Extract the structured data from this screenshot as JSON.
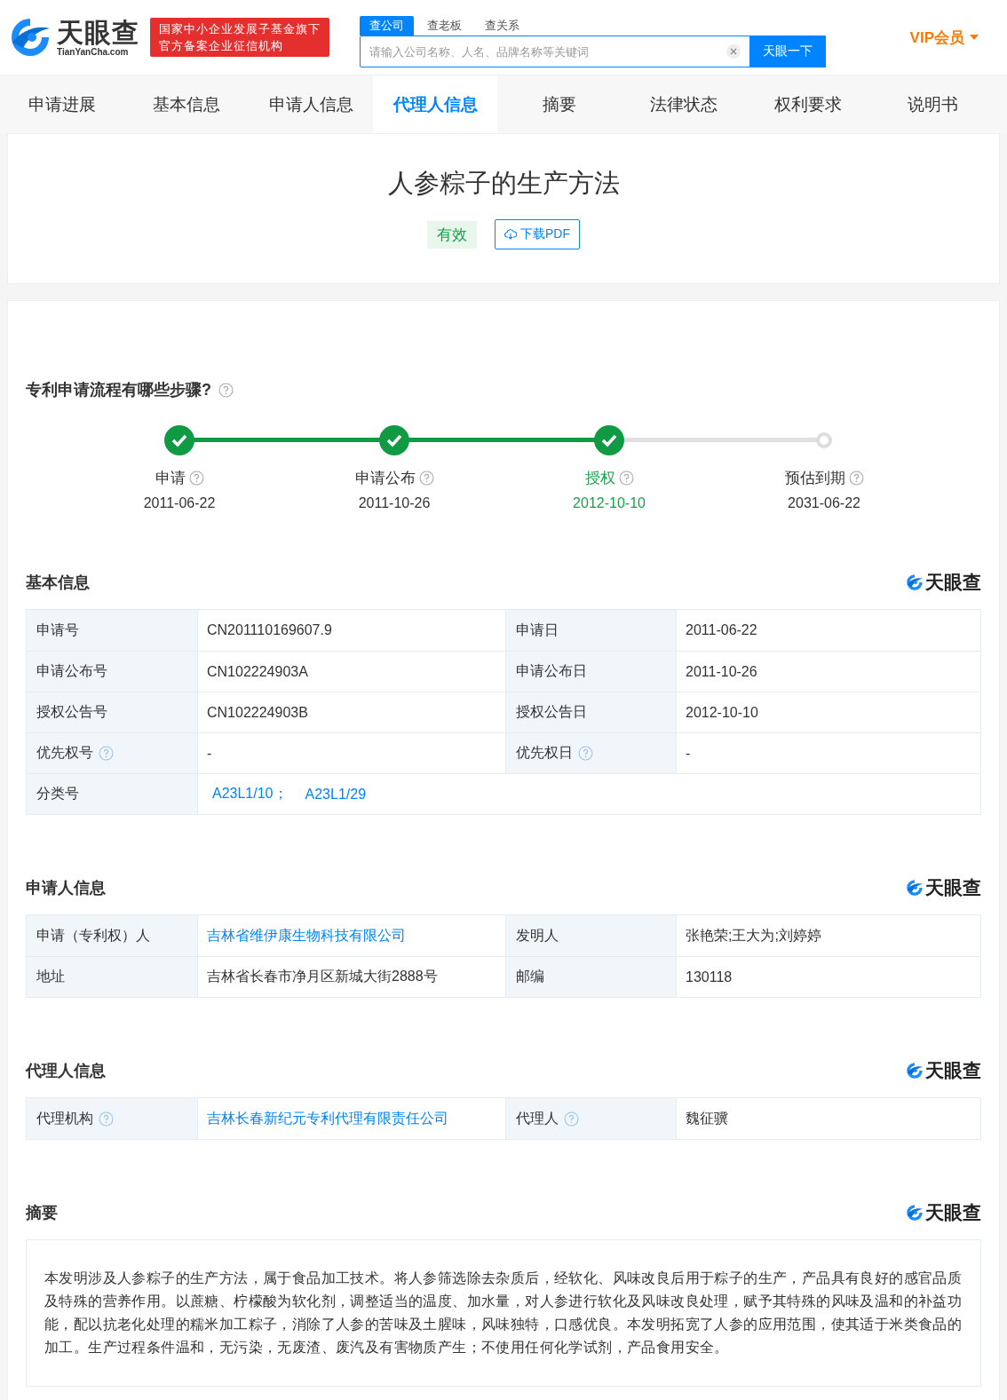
{
  "header": {
    "logo_name": "天眼查",
    "logo_domain": "TianYanCha.com",
    "badge_lines": [
      "国家中小企业发展子基金旗下",
      "官方备案企业征信机构"
    ],
    "search_tabs": [
      {
        "label": "查公司",
        "selected": true
      },
      {
        "label": "查老板",
        "selected": false
      },
      {
        "label": "查关系",
        "selected": false
      }
    ],
    "search_placeholder": "请输入公司名称、人名、品牌名称等关键词",
    "search_button": "天眼一下",
    "vip": "VIP会员"
  },
  "nav_tabs": [
    {
      "label": "申请进展",
      "selected": false
    },
    {
      "label": "基本信息",
      "selected": false
    },
    {
      "label": "申请人信息",
      "selected": false
    },
    {
      "label": "代理人信息",
      "selected": true
    },
    {
      "label": "摘要",
      "selected": false
    },
    {
      "label": "法律状态",
      "selected": false
    },
    {
      "label": "权利要求",
      "selected": false
    },
    {
      "label": "说明书",
      "selected": false
    }
  ],
  "title": "人参粽子的生产方法",
  "status": "有效",
  "download": "下载PDF",
  "process": {
    "title": "专利申请流程有哪些步骤?",
    "steps": [
      {
        "label": "申请",
        "date": "2011-06-22",
        "done": true,
        "current": false
      },
      {
        "label": "申请公布",
        "date": "2011-10-26",
        "done": true,
        "current": false
      },
      {
        "label": "授权",
        "date": "2012-10-10",
        "done": true,
        "current": true
      },
      {
        "label": "预估到期",
        "date": "2031-06-22",
        "done": false,
        "current": false
      }
    ]
  },
  "sections": [
    {
      "title": "基本信息",
      "brand": "天眼查",
      "rows": [
        [
          {
            "label": "申请号",
            "help": false,
            "value": "CN201110169607.9"
          },
          {
            "label": "申请日",
            "help": false,
            "value": "2011-06-22"
          }
        ],
        [
          {
            "label": "申请公布号",
            "help": false,
            "value": "CN102224903A"
          },
          {
            "label": "申请公布日",
            "help": false,
            "value": "2011-10-26"
          }
        ],
        [
          {
            "label": "授权公告号",
            "help": false,
            "value": "CN102224903B"
          },
          {
            "label": "授权公告日",
            "help": false,
            "value": "2012-10-10"
          }
        ],
        [
          {
            "label": "优先权号",
            "help": true,
            "value": "-"
          },
          {
            "label": "优先权日",
            "help": true,
            "value": "-"
          }
        ],
        [
          {
            "label": "分类号",
            "help": false,
            "links": [
              "A23L1/10；",
              "A23L1/29"
            ]
          }
        ]
      ]
    },
    {
      "title": "申请人信息",
      "brand": "天眼查",
      "rows": [
        [
          {
            "label": "申请（专利权）人",
            "help": false,
            "links": [
              "吉林省维伊康生物科技有限公司"
            ]
          },
          {
            "label": "发明人",
            "help": false,
            "value": "张艳荣;王大为;刘婷婷"
          }
        ],
        [
          {
            "label": "地址",
            "help": false,
            "value": "吉林省长春市净月区新城大街2888号"
          },
          {
            "label": "邮编",
            "help": false,
            "value": "130118"
          }
        ]
      ]
    },
    {
      "title": "代理人信息",
      "brand": "天眼查",
      "rows": [
        [
          {
            "label": "代理机构",
            "help": true,
            "links": [
              "吉林长春新纪元专利代理有限责任公司"
            ]
          },
          {
            "label": "代理人",
            "help": true,
            "value": "魏征骥"
          }
        ]
      ]
    }
  ],
  "abstract": {
    "title": "摘要",
    "brand": "天眼查",
    "text": "本发明涉及人参粽子的生产方法，属于食品加工技术。将人参筛选除去杂质后，经软化、风味改良后用于粽子的生产，产品具有良好的感官品质及特殊的营养作用。以蔗糖、柠檬酸为软化剂，调整适当的温度、加水量，对人参进行软化及风味改良处理，赋予其特殊的风味及温和的补益功能，配以抗老化处理的糯米加工粽子，消除了人参的苦味及土腥味，风味独特，口感优良。本发明拓宽了人参的应用范围，使其适于米类食品的加工。生产过程条件温和，无污染，无废渣、废汽及有害物质产生；不使用任何化学试剂，产品食用安全。"
  }
}
